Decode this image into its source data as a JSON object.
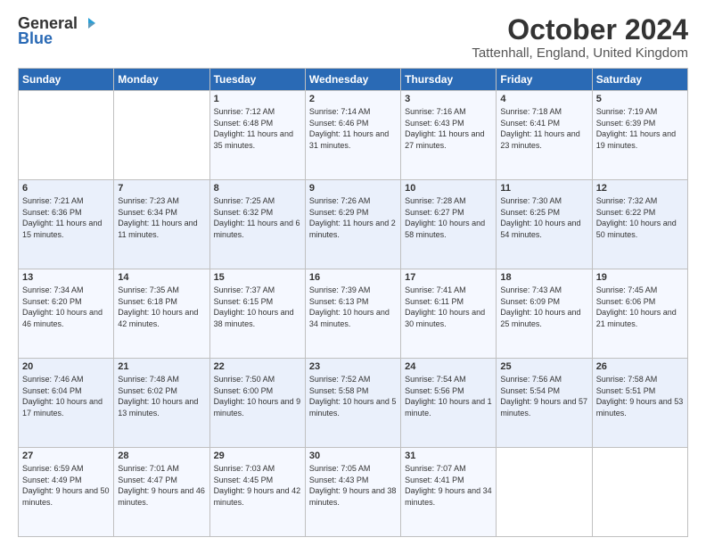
{
  "logo": {
    "general": "General",
    "blue": "Blue"
  },
  "header": {
    "month_title": "October 2024",
    "location": "Tattenhall, England, United Kingdom"
  },
  "days_of_week": [
    "Sunday",
    "Monday",
    "Tuesday",
    "Wednesday",
    "Thursday",
    "Friday",
    "Saturday"
  ],
  "weeks": [
    [
      {
        "num": "",
        "content": ""
      },
      {
        "num": "",
        "content": ""
      },
      {
        "num": "1",
        "content": "Sunrise: 7:12 AM\nSunset: 6:48 PM\nDaylight: 11 hours and 35 minutes."
      },
      {
        "num": "2",
        "content": "Sunrise: 7:14 AM\nSunset: 6:46 PM\nDaylight: 11 hours and 31 minutes."
      },
      {
        "num": "3",
        "content": "Sunrise: 7:16 AM\nSunset: 6:43 PM\nDaylight: 11 hours and 27 minutes."
      },
      {
        "num": "4",
        "content": "Sunrise: 7:18 AM\nSunset: 6:41 PM\nDaylight: 11 hours and 23 minutes."
      },
      {
        "num": "5",
        "content": "Sunrise: 7:19 AM\nSunset: 6:39 PM\nDaylight: 11 hours and 19 minutes."
      }
    ],
    [
      {
        "num": "6",
        "content": "Sunrise: 7:21 AM\nSunset: 6:36 PM\nDaylight: 11 hours and 15 minutes."
      },
      {
        "num": "7",
        "content": "Sunrise: 7:23 AM\nSunset: 6:34 PM\nDaylight: 11 hours and 11 minutes."
      },
      {
        "num": "8",
        "content": "Sunrise: 7:25 AM\nSunset: 6:32 PM\nDaylight: 11 hours and 6 minutes."
      },
      {
        "num": "9",
        "content": "Sunrise: 7:26 AM\nSunset: 6:29 PM\nDaylight: 11 hours and 2 minutes."
      },
      {
        "num": "10",
        "content": "Sunrise: 7:28 AM\nSunset: 6:27 PM\nDaylight: 10 hours and 58 minutes."
      },
      {
        "num": "11",
        "content": "Sunrise: 7:30 AM\nSunset: 6:25 PM\nDaylight: 10 hours and 54 minutes."
      },
      {
        "num": "12",
        "content": "Sunrise: 7:32 AM\nSunset: 6:22 PM\nDaylight: 10 hours and 50 minutes."
      }
    ],
    [
      {
        "num": "13",
        "content": "Sunrise: 7:34 AM\nSunset: 6:20 PM\nDaylight: 10 hours and 46 minutes."
      },
      {
        "num": "14",
        "content": "Sunrise: 7:35 AM\nSunset: 6:18 PM\nDaylight: 10 hours and 42 minutes."
      },
      {
        "num": "15",
        "content": "Sunrise: 7:37 AM\nSunset: 6:15 PM\nDaylight: 10 hours and 38 minutes."
      },
      {
        "num": "16",
        "content": "Sunrise: 7:39 AM\nSunset: 6:13 PM\nDaylight: 10 hours and 34 minutes."
      },
      {
        "num": "17",
        "content": "Sunrise: 7:41 AM\nSunset: 6:11 PM\nDaylight: 10 hours and 30 minutes."
      },
      {
        "num": "18",
        "content": "Sunrise: 7:43 AM\nSunset: 6:09 PM\nDaylight: 10 hours and 25 minutes."
      },
      {
        "num": "19",
        "content": "Sunrise: 7:45 AM\nSunset: 6:06 PM\nDaylight: 10 hours and 21 minutes."
      }
    ],
    [
      {
        "num": "20",
        "content": "Sunrise: 7:46 AM\nSunset: 6:04 PM\nDaylight: 10 hours and 17 minutes."
      },
      {
        "num": "21",
        "content": "Sunrise: 7:48 AM\nSunset: 6:02 PM\nDaylight: 10 hours and 13 minutes."
      },
      {
        "num": "22",
        "content": "Sunrise: 7:50 AM\nSunset: 6:00 PM\nDaylight: 10 hours and 9 minutes."
      },
      {
        "num": "23",
        "content": "Sunrise: 7:52 AM\nSunset: 5:58 PM\nDaylight: 10 hours and 5 minutes."
      },
      {
        "num": "24",
        "content": "Sunrise: 7:54 AM\nSunset: 5:56 PM\nDaylight: 10 hours and 1 minute."
      },
      {
        "num": "25",
        "content": "Sunrise: 7:56 AM\nSunset: 5:54 PM\nDaylight: 9 hours and 57 minutes."
      },
      {
        "num": "26",
        "content": "Sunrise: 7:58 AM\nSunset: 5:51 PM\nDaylight: 9 hours and 53 minutes."
      }
    ],
    [
      {
        "num": "27",
        "content": "Sunrise: 6:59 AM\nSunset: 4:49 PM\nDaylight: 9 hours and 50 minutes."
      },
      {
        "num": "28",
        "content": "Sunrise: 7:01 AM\nSunset: 4:47 PM\nDaylight: 9 hours and 46 minutes."
      },
      {
        "num": "29",
        "content": "Sunrise: 7:03 AM\nSunset: 4:45 PM\nDaylight: 9 hours and 42 minutes."
      },
      {
        "num": "30",
        "content": "Sunrise: 7:05 AM\nSunset: 4:43 PM\nDaylight: 9 hours and 38 minutes."
      },
      {
        "num": "31",
        "content": "Sunrise: 7:07 AM\nSunset: 4:41 PM\nDaylight: 9 hours and 34 minutes."
      },
      {
        "num": "",
        "content": ""
      },
      {
        "num": "",
        "content": ""
      }
    ]
  ]
}
